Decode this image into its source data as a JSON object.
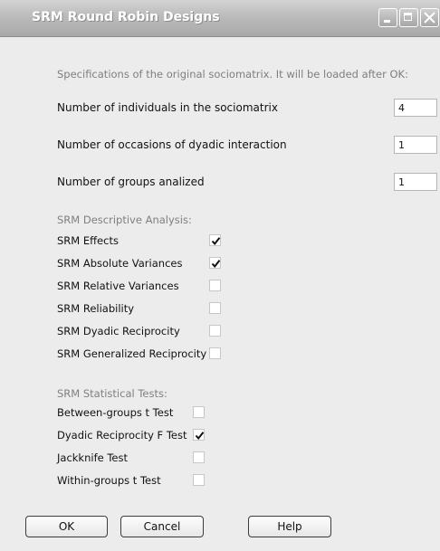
{
  "window": {
    "title": "SRM Round Robin Designs",
    "controls": [
      "minimize",
      "maximize",
      "close"
    ]
  },
  "intro_text": "Specifications of the original sociomatrix. It will be loaded after OK:",
  "fields": [
    {
      "label": "Number of individuals in the sociomatrix",
      "value": "4"
    },
    {
      "label": "Number of occasions of dyadic interaction",
      "value": "1"
    },
    {
      "label": "Number of groups analized",
      "value": "1"
    }
  ],
  "descriptive": {
    "title": "SRM Descriptive Analysis:",
    "items": [
      {
        "label": "SRM Effects",
        "checked": true
      },
      {
        "label": "SRM Absolute Variances",
        "checked": true
      },
      {
        "label": "SRM Relative Variances",
        "checked": false
      },
      {
        "label": "SRM Reliability",
        "checked": false
      },
      {
        "label": "SRM Dyadic Reciprocity",
        "checked": false
      },
      {
        "label": "SRM Generalized Reciprocity",
        "checked": false
      }
    ]
  },
  "tests": {
    "title": "SRM Statistical Tests:",
    "items": [
      {
        "label": "Between-groups t Test",
        "checked": false
      },
      {
        "label": "Dyadic Reciprocity F Test",
        "checked": true
      },
      {
        "label": "Jackknife Test",
        "checked": false
      },
      {
        "label": "Within-groups t Test",
        "checked": false
      }
    ]
  },
  "buttons": {
    "ok": "OK",
    "cancel": "Cancel",
    "help": "Help"
  }
}
